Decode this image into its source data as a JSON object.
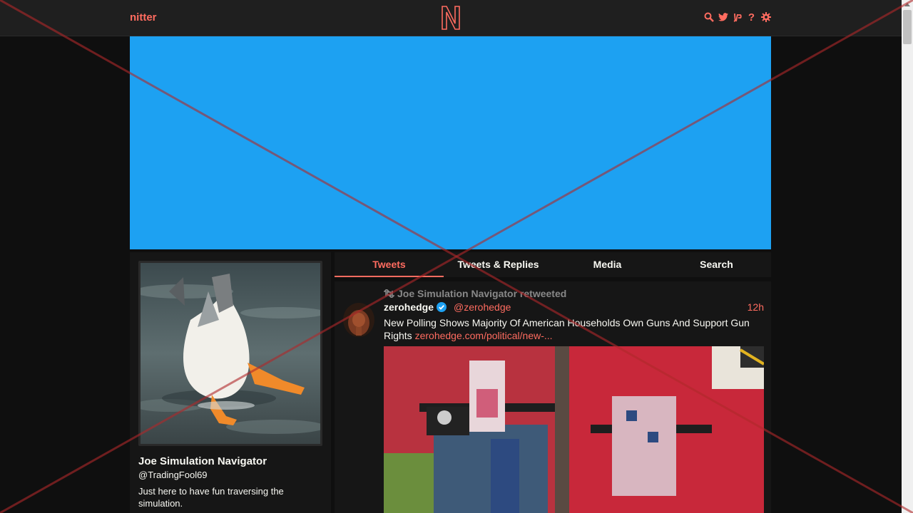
{
  "navbar": {
    "brand": "nitter",
    "logo_letter": "N",
    "icons": [
      "search-icon",
      "twitter-icon",
      "rss-icon",
      "help-icon",
      "gear-icon"
    ],
    "help_glyph": "?"
  },
  "banner": {
    "color": "#1da1f2"
  },
  "profile": {
    "fullname": "Joe Simulation Navigator",
    "username": "@TradingFool69",
    "bio": "Just here to have fun traversing the simulation."
  },
  "tabs": [
    {
      "label": "Tweets",
      "active": true
    },
    {
      "label": "Tweets & Replies",
      "active": false
    },
    {
      "label": "Media",
      "active": false
    },
    {
      "label": "Search",
      "active": false
    }
  ],
  "tweet": {
    "retweet_header": "Joe Simulation Navigator retweeted",
    "fullname": "zerohedge",
    "username": "@zerohedge",
    "date": "12h",
    "text": "New Polling Shows Majority Of American Households Own Guns And Support Gun Rights ",
    "link": "zerohedge.com/political/new-..."
  },
  "colors": {
    "accent": "#ff6c60",
    "background": "#0f0f0f",
    "panel": "#161616"
  }
}
